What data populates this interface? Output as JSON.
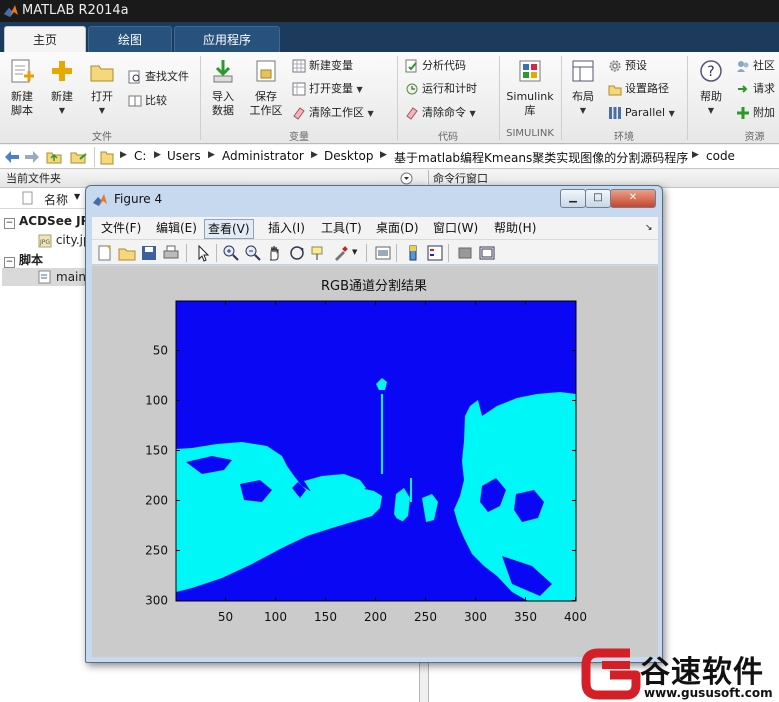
{
  "app": {
    "title": "MATLAB R2014a"
  },
  "tabs": [
    {
      "label": "主页",
      "active": true
    },
    {
      "label": "绘图",
      "active": false
    },
    {
      "label": "应用程序",
      "active": false
    }
  ],
  "ribbon": {
    "file": {
      "new_script": "新建\n脚本",
      "new": "新建",
      "open": "打开",
      "find_files": "查找文件",
      "compare": "比较",
      "group": "文件"
    },
    "variable": {
      "import": "导入\n数据",
      "save_ws": "保存\n工作区",
      "new_var": "新建变量",
      "open_var": "打开变量",
      "clear_ws": "清除工作区",
      "group": "变量"
    },
    "code": {
      "analyze": "分析代码",
      "run_time": "运行和计时",
      "clear_cmd": "清除命令",
      "group": "代码"
    },
    "simulink": {
      "lib": "Simulink\n库",
      "group": "SIMULINK"
    },
    "env": {
      "layout": "布局",
      "prefs": "预设",
      "set_path": "设置路径",
      "parallel": "Parallel",
      "group": "环境"
    },
    "resources": {
      "help": "帮助",
      "community": "社区",
      "request": "请求",
      "addons": "附加",
      "group": "资源"
    }
  },
  "address": {
    "segments": [
      "C:",
      "Users",
      "Administrator",
      "Desktop",
      "基于matlab编程Kmeans聚类实现图像的分割源码程序",
      "code"
    ]
  },
  "current_folder": {
    "header": "当前文件夹",
    "col_name": "名称",
    "groups": [
      {
        "label": "ACDSee JP",
        "items": [
          "city.jp"
        ]
      },
      {
        "label": "脚本",
        "items": [
          "main"
        ]
      }
    ]
  },
  "command_window": {
    "header": "命令行窗口"
  },
  "figure": {
    "title": "Figure 4",
    "menus": [
      "文件(F)",
      "编辑(E)",
      "查看(V)",
      "插入(I)",
      "工具(T)",
      "桌面(D)",
      "窗口(W)",
      "帮助(H)"
    ],
    "active_menu": "查看(V)"
  },
  "chart_data": {
    "type": "image",
    "title": "RGB通道分割结果",
    "xlim": [
      0.5,
      400.5
    ],
    "ylim": [
      0.5,
      300.5
    ],
    "xticks": [
      50,
      100,
      150,
      200,
      250,
      300,
      350,
      400
    ],
    "yticks": [
      50,
      100,
      150,
      200,
      250,
      300
    ],
    "y_reversed": true,
    "colors": {
      "cluster_1": "#0a07f5",
      "cluster_2": "#00f7f7"
    }
  },
  "watermark": {
    "brand": "谷速软件",
    "url": "www.gususoft.com"
  },
  "colors": {
    "ribbon_dark": "#1b3a5c",
    "figure_frame": "#c6d9ee",
    "plot_bg": "#cbcbcb"
  }
}
